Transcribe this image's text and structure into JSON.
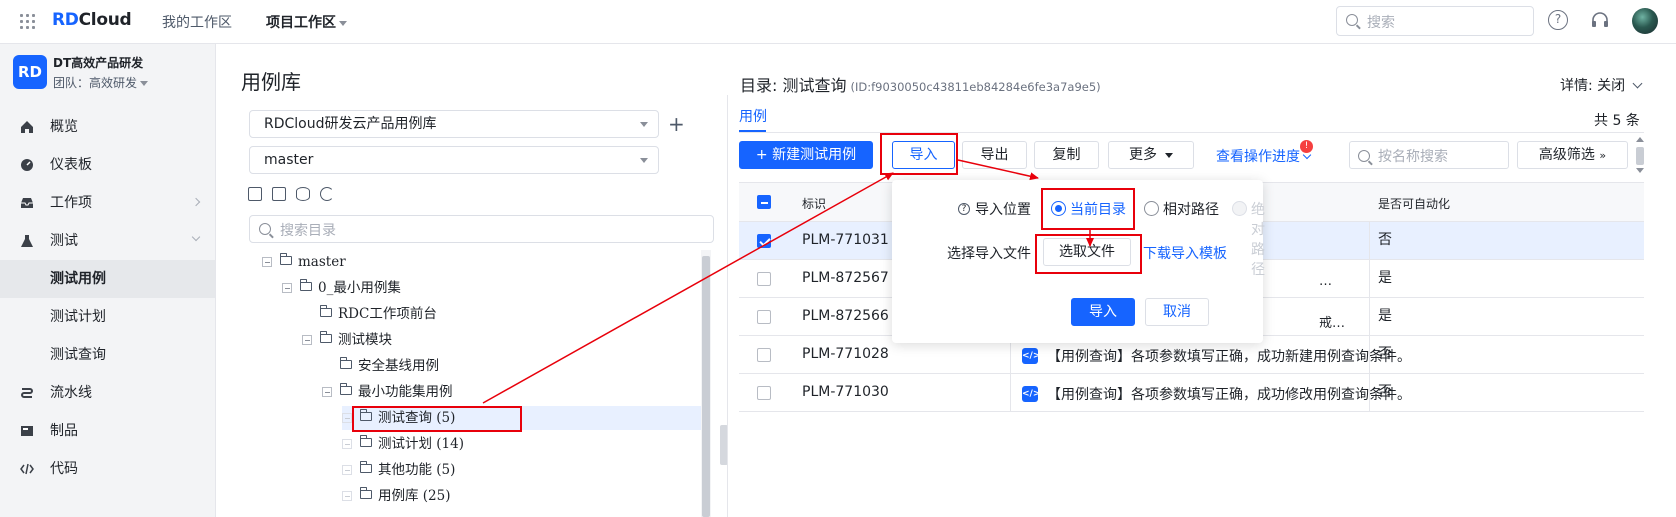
{
  "topbar": {
    "logo_rd": "RD",
    "logo_cloud": "Cloud",
    "nav": [
      "我的工作区",
      "项目工作区"
    ],
    "search_placeholder": "搜索",
    "help_label": "?"
  },
  "sidebar": {
    "project_logo": "RD",
    "project_name": "DT高效产品研发",
    "team": "团队：高效研发",
    "items": [
      {
        "label": "概览",
        "icon": "home-icon"
      },
      {
        "label": "仪表板",
        "icon": "dashboard-icon"
      },
      {
        "label": "工作项",
        "icon": "inbox-icon"
      },
      {
        "label": "测试",
        "icon": "flask-icon"
      },
      {
        "label": "测试用例"
      },
      {
        "label": "测试计划"
      },
      {
        "label": "测试查询"
      },
      {
        "label": "流水线",
        "icon": "pipeline-icon"
      },
      {
        "label": "制品",
        "icon": "artifact-icon"
      },
      {
        "label": "代码",
        "icon": "code-icon"
      }
    ]
  },
  "library": {
    "title": "用例库",
    "library_select": "RDCloud研发云产品用例库",
    "branch_select": "master",
    "add_label": "+",
    "search_placeholder": "搜索目录",
    "tree": [
      {
        "label": "master"
      },
      {
        "label": "0_最小用例集"
      },
      {
        "label": "RDC工作项前台"
      },
      {
        "label": "测试模块"
      },
      {
        "label": "安全基线用例"
      },
      {
        "label": "最小功能集用例"
      },
      {
        "label": "测试查询 (5)"
      },
      {
        "label": "测试计划 (14)"
      },
      {
        "label": "其他功能 (5)"
      },
      {
        "label": "用例库 (25)"
      }
    ]
  },
  "directory": {
    "title": "目录: 测试查询",
    "id": "(ID:f9030050c43811eb84284e6fe3a7a9e5)",
    "detail": "详情: 关闭",
    "tab": "用例",
    "count": "共 5 条"
  },
  "toolbar": {
    "new_case": "+ 新建测试用例",
    "import": "导入",
    "export": "导出",
    "copy": "复制",
    "more": "更多",
    "view_progress": "查看操作进度",
    "badge": "!",
    "search_placeholder": "按名称搜索",
    "advanced_filter": "高级筛选"
  },
  "table": {
    "headers": [
      "标识",
      "是否可自动化"
    ],
    "rows": [
      {
        "id": "PLM-771031",
        "name": "",
        "auto": "否",
        "selected": true,
        "frag": ""
      },
      {
        "id": "PLM-872567",
        "name": "",
        "auto": "是",
        "selected": false,
        "frag": "…"
      },
      {
        "id": "PLM-872566",
        "name": "",
        "auto": "是",
        "selected": false,
        "frag": "戒…"
      },
      {
        "id": "PLM-771028",
        "name": "【用例查询】各项参数填写正确，成功新建用例查询条件。",
        "auto": "否",
        "selected": false,
        "frag": ""
      },
      {
        "id": "PLM-771030",
        "name": "【用例查询】各项参数填写正确，成功修改用例查询条件。",
        "auto": "否",
        "selected": false,
        "frag": ""
      }
    ],
    "code_icon_text": "</>"
  },
  "popover": {
    "position_label": "导入位置",
    "options": [
      "当前目录",
      "相对路径",
      "绝对路径"
    ],
    "file_label": "选择导入文件",
    "choose_file": "选取文件",
    "download_template": "下载导入模板",
    "confirm": "导入",
    "cancel": "取消"
  },
  "colors": {
    "primary": "#1664ff",
    "annotation_red": "#e8000b",
    "sidebar_bg": "#f3f4f6"
  }
}
